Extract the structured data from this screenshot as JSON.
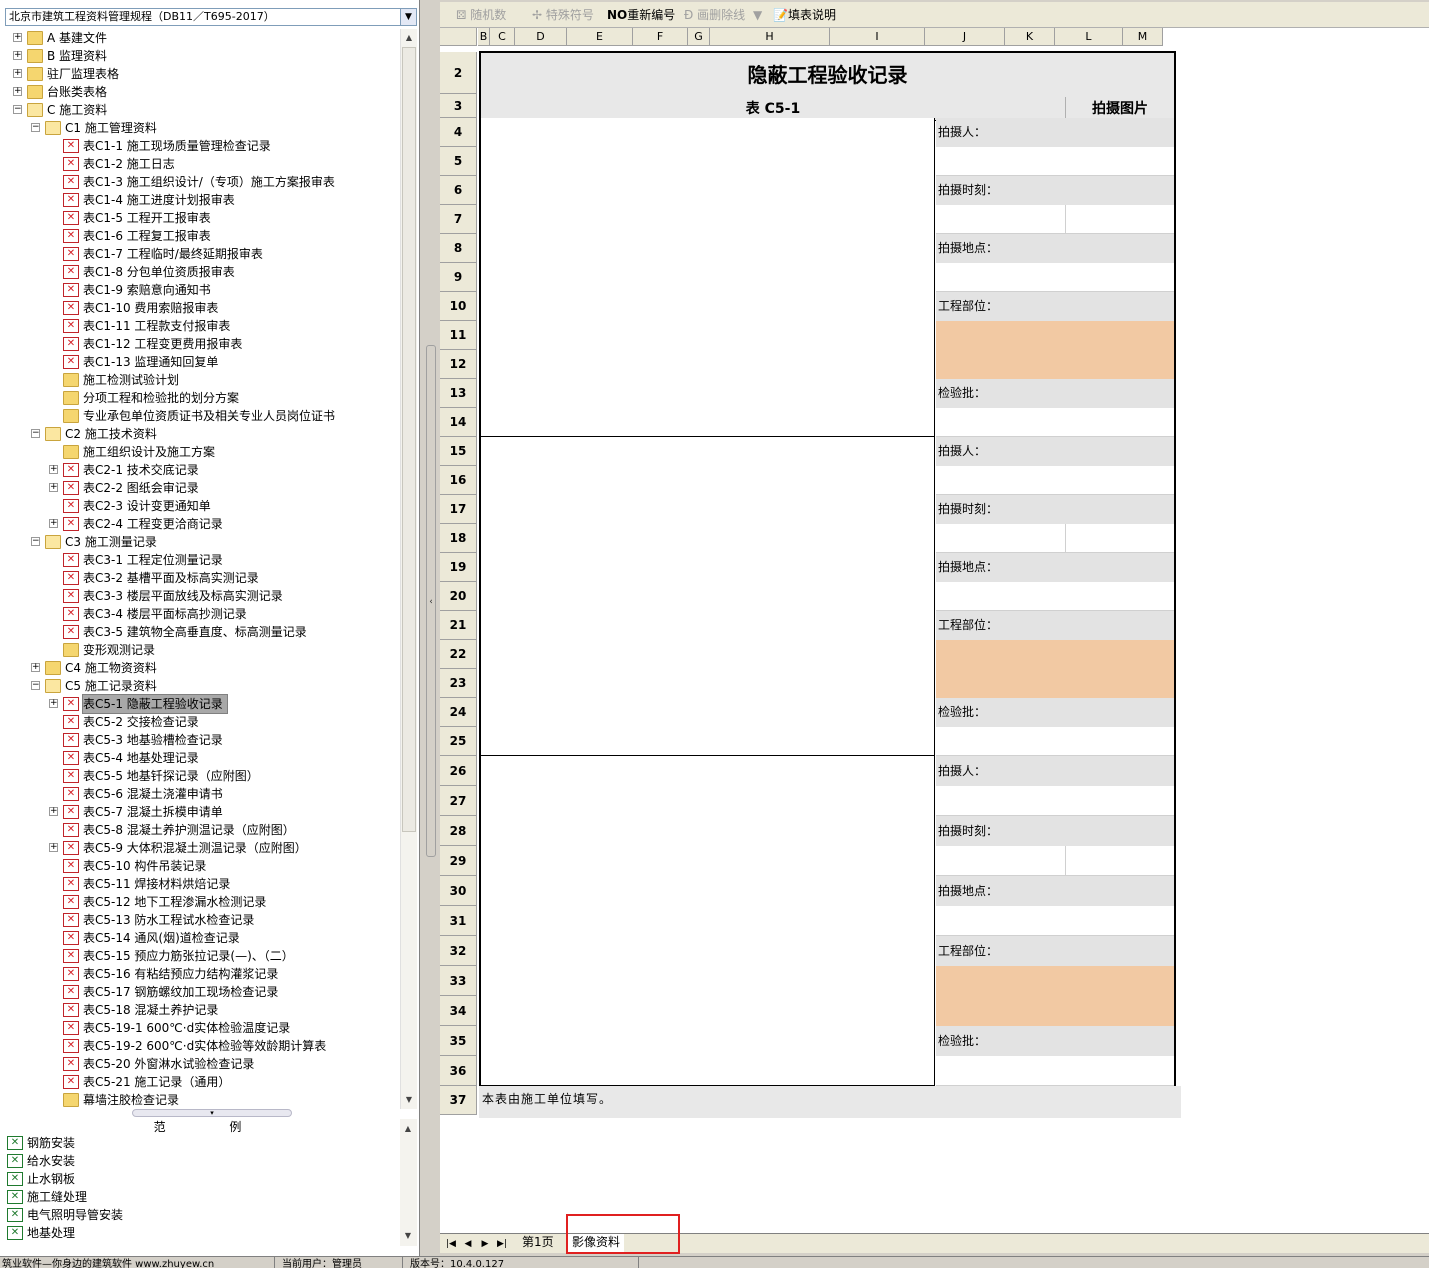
{
  "combo": {
    "value": "北京市建筑工程资料管理规程（DB11／T695-2017）",
    "arrow": "▼"
  },
  "tree": {
    "items": [
      {
        "level": 0,
        "kind": "folder",
        "expander": "+",
        "label": "A 基建文件"
      },
      {
        "level": 0,
        "kind": "folder",
        "expander": "+",
        "label": "B 监理资料"
      },
      {
        "level": 0,
        "kind": "folder",
        "expander": "+",
        "label": "驻厂监理表格"
      },
      {
        "level": 0,
        "kind": "folder",
        "expander": "+",
        "label": "台账类表格"
      },
      {
        "level": 0,
        "kind": "folder-open",
        "expander": "−",
        "label": "C 施工资料"
      },
      {
        "level": 1,
        "kind": "folder-open",
        "expander": "−",
        "label": "C1 施工管理资料"
      },
      {
        "level": 2,
        "kind": "form",
        "expander": "",
        "label": "表C1-1 施工现场质量管理检查记录"
      },
      {
        "level": 2,
        "kind": "form",
        "expander": "",
        "label": "表C1-2 施工日志"
      },
      {
        "level": 2,
        "kind": "form",
        "expander": "",
        "label": "表C1-3 施工组织设计/（专项）施工方案报审表"
      },
      {
        "level": 2,
        "kind": "form",
        "expander": "",
        "label": "表C1-4 施工进度计划报审表"
      },
      {
        "level": 2,
        "kind": "form",
        "expander": "",
        "label": "表C1-5 工程开工报审表"
      },
      {
        "level": 2,
        "kind": "form",
        "expander": "",
        "label": "表C1-6 工程复工报审表"
      },
      {
        "level": 2,
        "kind": "form",
        "expander": "",
        "label": "表C1-7 工程临时/最终延期报审表"
      },
      {
        "level": 2,
        "kind": "form",
        "expander": "",
        "label": "表C1-8 分包单位资质报审表"
      },
      {
        "level": 2,
        "kind": "form",
        "expander": "",
        "label": "表C1-9 索赔意向通知书"
      },
      {
        "level": 2,
        "kind": "form",
        "expander": "",
        "label": "表C1-10 费用索赔报审表"
      },
      {
        "level": 2,
        "kind": "form",
        "expander": "",
        "label": "表C1-11 工程款支付报审表"
      },
      {
        "level": 2,
        "kind": "form",
        "expander": "",
        "label": "表C1-12 工程变更费用报审表"
      },
      {
        "level": 2,
        "kind": "form",
        "expander": "",
        "label": "表C1-13 监理通知回复单"
      },
      {
        "level": 2,
        "kind": "folder",
        "expander": "",
        "label": "施工检测试验计划"
      },
      {
        "level": 2,
        "kind": "folder",
        "expander": "",
        "label": "分项工程和检验批的划分方案"
      },
      {
        "level": 2,
        "kind": "folder",
        "expander": "",
        "label": "专业承包单位资质证书及相关专业人员岗位证书"
      },
      {
        "level": 1,
        "kind": "folder-open",
        "expander": "−",
        "label": "C2 施工技术资料"
      },
      {
        "level": 2,
        "kind": "folder",
        "expander": "",
        "label": "施工组织设计及施工方案"
      },
      {
        "level": 2,
        "kind": "form",
        "expander": "+",
        "label": "表C2-1 技术交底记录"
      },
      {
        "level": 2,
        "kind": "form",
        "expander": "+",
        "label": "表C2-2 图纸会审记录"
      },
      {
        "level": 2,
        "kind": "form",
        "expander": "",
        "label": "表C2-3 设计变更通知单"
      },
      {
        "level": 2,
        "kind": "form",
        "expander": "+",
        "label": "表C2-4 工程变更洽商记录"
      },
      {
        "level": 1,
        "kind": "folder-open",
        "expander": "−",
        "label": "C3 施工测量记录"
      },
      {
        "level": 2,
        "kind": "form",
        "expander": "",
        "label": "表C3-1 工程定位测量记录"
      },
      {
        "level": 2,
        "kind": "form",
        "expander": "",
        "label": "表C3-2 基槽平面及标高实测记录"
      },
      {
        "level": 2,
        "kind": "form",
        "expander": "",
        "label": "表C3-3 楼层平面放线及标高实测记录"
      },
      {
        "level": 2,
        "kind": "form",
        "expander": "",
        "label": "表C3-4 楼层平面标高抄测记录"
      },
      {
        "level": 2,
        "kind": "form",
        "expander": "",
        "label": "表C3-5 建筑物全高垂直度、标高测量记录"
      },
      {
        "level": 2,
        "kind": "folder",
        "expander": "",
        "label": "变形观测记录"
      },
      {
        "level": 1,
        "kind": "folder",
        "expander": "+",
        "label": "C4 施工物资资料"
      },
      {
        "level": 1,
        "kind": "folder-open",
        "expander": "−",
        "label": "C5 施工记录资料"
      },
      {
        "level": 2,
        "kind": "form",
        "expander": "+",
        "label": "表C5-1 隐蔽工程验收记录",
        "selected": true
      },
      {
        "level": 2,
        "kind": "form",
        "expander": "",
        "label": "表C5-2 交接检查记录"
      },
      {
        "level": 2,
        "kind": "form",
        "expander": "",
        "label": "表C5-3 地基验槽检查记录"
      },
      {
        "level": 2,
        "kind": "form",
        "expander": "",
        "label": "表C5-4 地基处理记录"
      },
      {
        "level": 2,
        "kind": "form",
        "expander": "",
        "label": "表C5-5 地基钎探记录（应附图）"
      },
      {
        "level": 2,
        "kind": "form",
        "expander": "",
        "label": "表C5-6 混凝土浇灌申请书"
      },
      {
        "level": 2,
        "kind": "form",
        "expander": "+",
        "label": "表C5-7 混凝土拆模申请单"
      },
      {
        "level": 2,
        "kind": "form",
        "expander": "",
        "label": "表C5-8 混凝土养护测温记录（应附图）"
      },
      {
        "level": 2,
        "kind": "form",
        "expander": "+",
        "label": "表C5-9 大体积混凝土测温记录（应附图）"
      },
      {
        "level": 2,
        "kind": "form",
        "expander": "",
        "label": "表C5-10 构件吊装记录"
      },
      {
        "level": 2,
        "kind": "form",
        "expander": "",
        "label": "表C5-11 焊接材料烘焙记录"
      },
      {
        "level": 2,
        "kind": "form",
        "expander": "",
        "label": "表C5-12 地下工程渗漏水检测记录"
      },
      {
        "level": 2,
        "kind": "form",
        "expander": "",
        "label": "表C5-13 防水工程试水检查记录"
      },
      {
        "level": 2,
        "kind": "form",
        "expander": "",
        "label": "表C5-14 通风(烟)道检查记录"
      },
      {
        "level": 2,
        "kind": "form",
        "expander": "",
        "label": "表C5-15 预应力筋张拉记录(—)、（二）"
      },
      {
        "level": 2,
        "kind": "form",
        "expander": "",
        "label": "表C5-16 有粘结预应力结构灌浆记录"
      },
      {
        "level": 2,
        "kind": "form",
        "expander": "",
        "label": "表C5-17 钢筋螺纹加工现场检查记录"
      },
      {
        "level": 2,
        "kind": "form",
        "expander": "",
        "label": "表C5-18 混凝土养护记录"
      },
      {
        "level": 2,
        "kind": "form",
        "expander": "",
        "label": "表C5-19-1 600℃·d实体检验温度记录"
      },
      {
        "level": 2,
        "kind": "form",
        "expander": "",
        "label": "表C5-19-2 600℃·d实体检验等效龄期计算表"
      },
      {
        "level": 2,
        "kind": "form",
        "expander": "",
        "label": "表C5-20 外窗淋水试验检查记录"
      },
      {
        "level": 2,
        "kind": "form",
        "expander": "",
        "label": "表C5-21 施工记录（通用）"
      },
      {
        "level": 2,
        "kind": "folder",
        "expander": "",
        "label": "幕墙注胶检查记录"
      }
    ]
  },
  "examples": {
    "header": "范 例",
    "items": [
      "钢筋安装",
      "给水安装",
      "止水钢板",
      "施工缝处理",
      "电气照明导管安装",
      "地基处理"
    ]
  },
  "toolbar": {
    "random_data": "随机数",
    "special_symbol": "特殊符号",
    "renumber_prefix": "NO",
    "renumber": "重新编号",
    "strikeout": "画删除线",
    "fill_instructions": "填表说明"
  },
  "columns": [
    "B",
    "C",
    "D",
    "E",
    "F",
    "G",
    "H",
    "I",
    "J",
    "K",
    "L",
    "M"
  ],
  "rows": [
    "2",
    "3",
    "4",
    "5",
    "6",
    "7",
    "8",
    "9",
    "10",
    "11",
    "12",
    "13",
    "14",
    "15",
    "16",
    "17",
    "18",
    "19",
    "20",
    "21",
    "22",
    "23",
    "24",
    "25",
    "26",
    "27",
    "28",
    "29",
    "30",
    "31",
    "32",
    "33",
    "34",
    "35",
    "36",
    "37"
  ],
  "form": {
    "title": "隐蔽工程验收记录",
    "table_no": "表 C5-1",
    "photo_header": "拍摄图片",
    "labels": {
      "photographer": "拍摄人：",
      "time": "拍摄时刻：",
      "place": "拍摄地点：",
      "location": "工程部位：",
      "batch": "检验批："
    },
    "note": "本表由施工单位填写。"
  },
  "tabs": {
    "nav": [
      "|◀",
      "◀",
      "▶",
      "▶|"
    ],
    "sheets": [
      "第1页",
      "影像资料"
    ],
    "active": 1
  },
  "status": {
    "slogan": "筑业软件—你身边的建筑软件 www.zhuyew.cn",
    "user": "当前用户：管理员",
    "version": "版本号：10.4.0.127"
  },
  "colors": {
    "accent_highlight": "#e02020",
    "peach_cell": "#f2c9a3",
    "selection": "#a8a8a8"
  }
}
